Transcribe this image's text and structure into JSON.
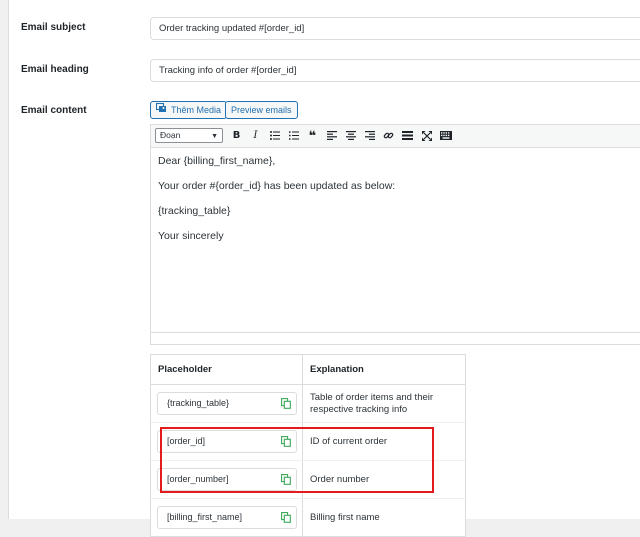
{
  "fields": {
    "subject_label": "Email subject",
    "subject_value": "Order tracking updated #[order_id]",
    "heading_label": "Email heading",
    "heading_value": "Tracking info of order #[order_id]",
    "content_label": "Email content"
  },
  "editor": {
    "add_media_label": "Thêm Media",
    "preview_label": "Preview emails",
    "format_value": "Đoạn",
    "toolbar_icons": [
      "bold-icon",
      "italic-icon",
      "bullet-list-icon",
      "numbered-list-icon",
      "blockquote-icon",
      "align-left-icon",
      "align-center-icon",
      "align-right-icon",
      "link-icon",
      "read-more-icon",
      "fullscreen-icon",
      "keyboard-icon"
    ],
    "lines": [
      "Dear {billing_first_name},",
      "Your order #{order_id} has been updated as below:",
      "{tracking_table}",
      "Your sincerely"
    ]
  },
  "placeholders": {
    "col_placeholder": "Placeholder",
    "col_explanation": "Explanation",
    "rows": [
      {
        "code": "{tracking_table}",
        "explanation": "Table of order items and their respective tracking info"
      },
      {
        "code": "[order_id]",
        "explanation": "ID of current order"
      },
      {
        "code": "[order_number]",
        "explanation": "Order number"
      },
      {
        "code": "[billing_first_name]",
        "explanation": "Billing first name"
      }
    ]
  },
  "colors": {
    "accent": "#2271b1",
    "copy_icon": "#3aa757",
    "highlight": "#e31b1b"
  }
}
